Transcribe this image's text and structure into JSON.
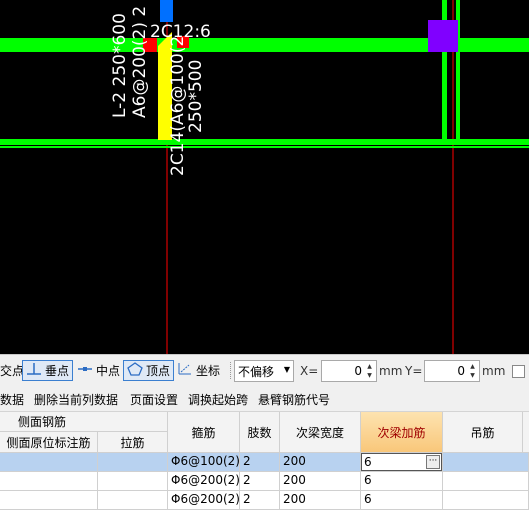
{
  "canvas": {
    "labels": {
      "beam_left": "L-2 250*600",
      "stirrup_left": "A6@200(2) 2",
      "top_text": "2C12:6",
      "beam_right_name": "2C14(A6@100(2",
      "beam_right_size": "250*500"
    },
    "colors": {
      "beam": "#00ff00",
      "axis": "#ff0000",
      "rebar": "#ffff00",
      "column": "#8000ff",
      "blue": "#0070ff"
    }
  },
  "snap_toolbar": {
    "items": [
      {
        "label": "交点",
        "active": false,
        "icon": "intersection-icon"
      },
      {
        "label": "垂点",
        "active": true,
        "icon": "perpendicular-icon"
      },
      {
        "label": "中点",
        "active": false,
        "icon": "midpoint-icon"
      },
      {
        "label": "顶点",
        "active": true,
        "icon": "vertex-icon"
      },
      {
        "label": "坐标",
        "active": false,
        "icon": "coordinate-icon"
      }
    ],
    "offset_mode": "不偏移",
    "x_label": "X=",
    "x_value": "0",
    "y_label": "Y=",
    "y_value": "0",
    "unit": "mm"
  },
  "menu": {
    "items": [
      "数据",
      "删除当前列数据",
      "页面设置",
      "调换起始跨",
      "悬臂钢筋代号"
    ]
  },
  "table": {
    "group_header": "侧面钢筋",
    "sub_headers": [
      "侧面原位标注筋",
      "拉筋"
    ],
    "headers": [
      "箍筋",
      "肢数",
      "次梁宽度",
      "次梁加筋",
      "吊筋"
    ],
    "rows": [
      {
        "stirrup": "Φ6@100(2)",
        "legs": "2",
        "width": "200",
        "add_bars": "6",
        "hanger": ""
      },
      {
        "stirrup": "Φ6@200(2)",
        "legs": "2",
        "width": "200",
        "add_bars": "6",
        "hanger": ""
      },
      {
        "stirrup": "Φ6@200(2)",
        "legs": "2",
        "width": "200",
        "add_bars": "6",
        "hanger": ""
      }
    ]
  }
}
